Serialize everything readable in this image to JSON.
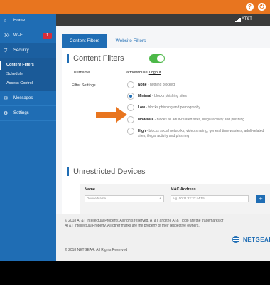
{
  "topbar": {
    "help_glyph": "?",
    "power_glyph": "⏻"
  },
  "header": {
    "carrier": "AT&T",
    "extra": "5"
  },
  "sidebar": {
    "items": [
      {
        "label": "Home",
        "icon": "home-icon",
        "glyph": "⌂"
      },
      {
        "label": "Wi-Fi",
        "icon": "wifi-icon",
        "glyph": "((•))",
        "badge": "1"
      },
      {
        "label": "Security",
        "icon": "shield-icon",
        "glyph": "⛉"
      }
    ],
    "security_sub": [
      "Content Filters",
      "Schedule",
      "Access Control"
    ],
    "items2": [
      {
        "label": "Messages",
        "icon": "envelope-icon",
        "glyph": "✉"
      },
      {
        "label": "Settings",
        "icon": "gear-icon",
        "glyph": "⚙"
      }
    ]
  },
  "tabs": {
    "content_filters": "Content Filters",
    "website_filters": "Website Filters"
  },
  "content_filters": {
    "title": "Content Filters",
    "toggle_on": true,
    "username_label": "Username",
    "username_value": "atthowtouse",
    "logout": "Logout",
    "filter_settings_label": "Filter Settings",
    "options": [
      {
        "name": "None",
        "desc": " - nothing blocked",
        "selected": false
      },
      {
        "name": "Minimal",
        "desc": " - blocks phishing sites",
        "selected": true
      },
      {
        "name": "Low",
        "desc": " - blocks phishing and pornography",
        "selected": false
      },
      {
        "name": "Moderate",
        "desc": " - blocks all adult-related sites, illegal activity and phishing",
        "selected": false
      },
      {
        "name": "High",
        "desc": " - blocks social networks, video sharing, general time wasters, adult-related sites, illegal activity and phishing",
        "selected": false
      }
    ]
  },
  "unrestricted": {
    "title": "Unrestricted Devices",
    "name_header": "Name",
    "mac_header": "MAC Address",
    "name_placeholder": "Device Name",
    "mac_placeholder": "e.g. 00:11:22:33:44:55",
    "add_label": "+"
  },
  "footer": {
    "legal": "© 2018 AT&T Intellectual Property. All rights reserved. AT&T and the AT&T logo are the trademarks of AT&T Intellectual Property. All other marks are the property of their respective owners.",
    "copyright": "© 2018 NETGEAR. All Rights Reserved",
    "netgear": "NETGEAR"
  },
  "colors": {
    "accent": "#1f6db4",
    "orange": "#e8751f",
    "toggle": "#4cb848"
  }
}
